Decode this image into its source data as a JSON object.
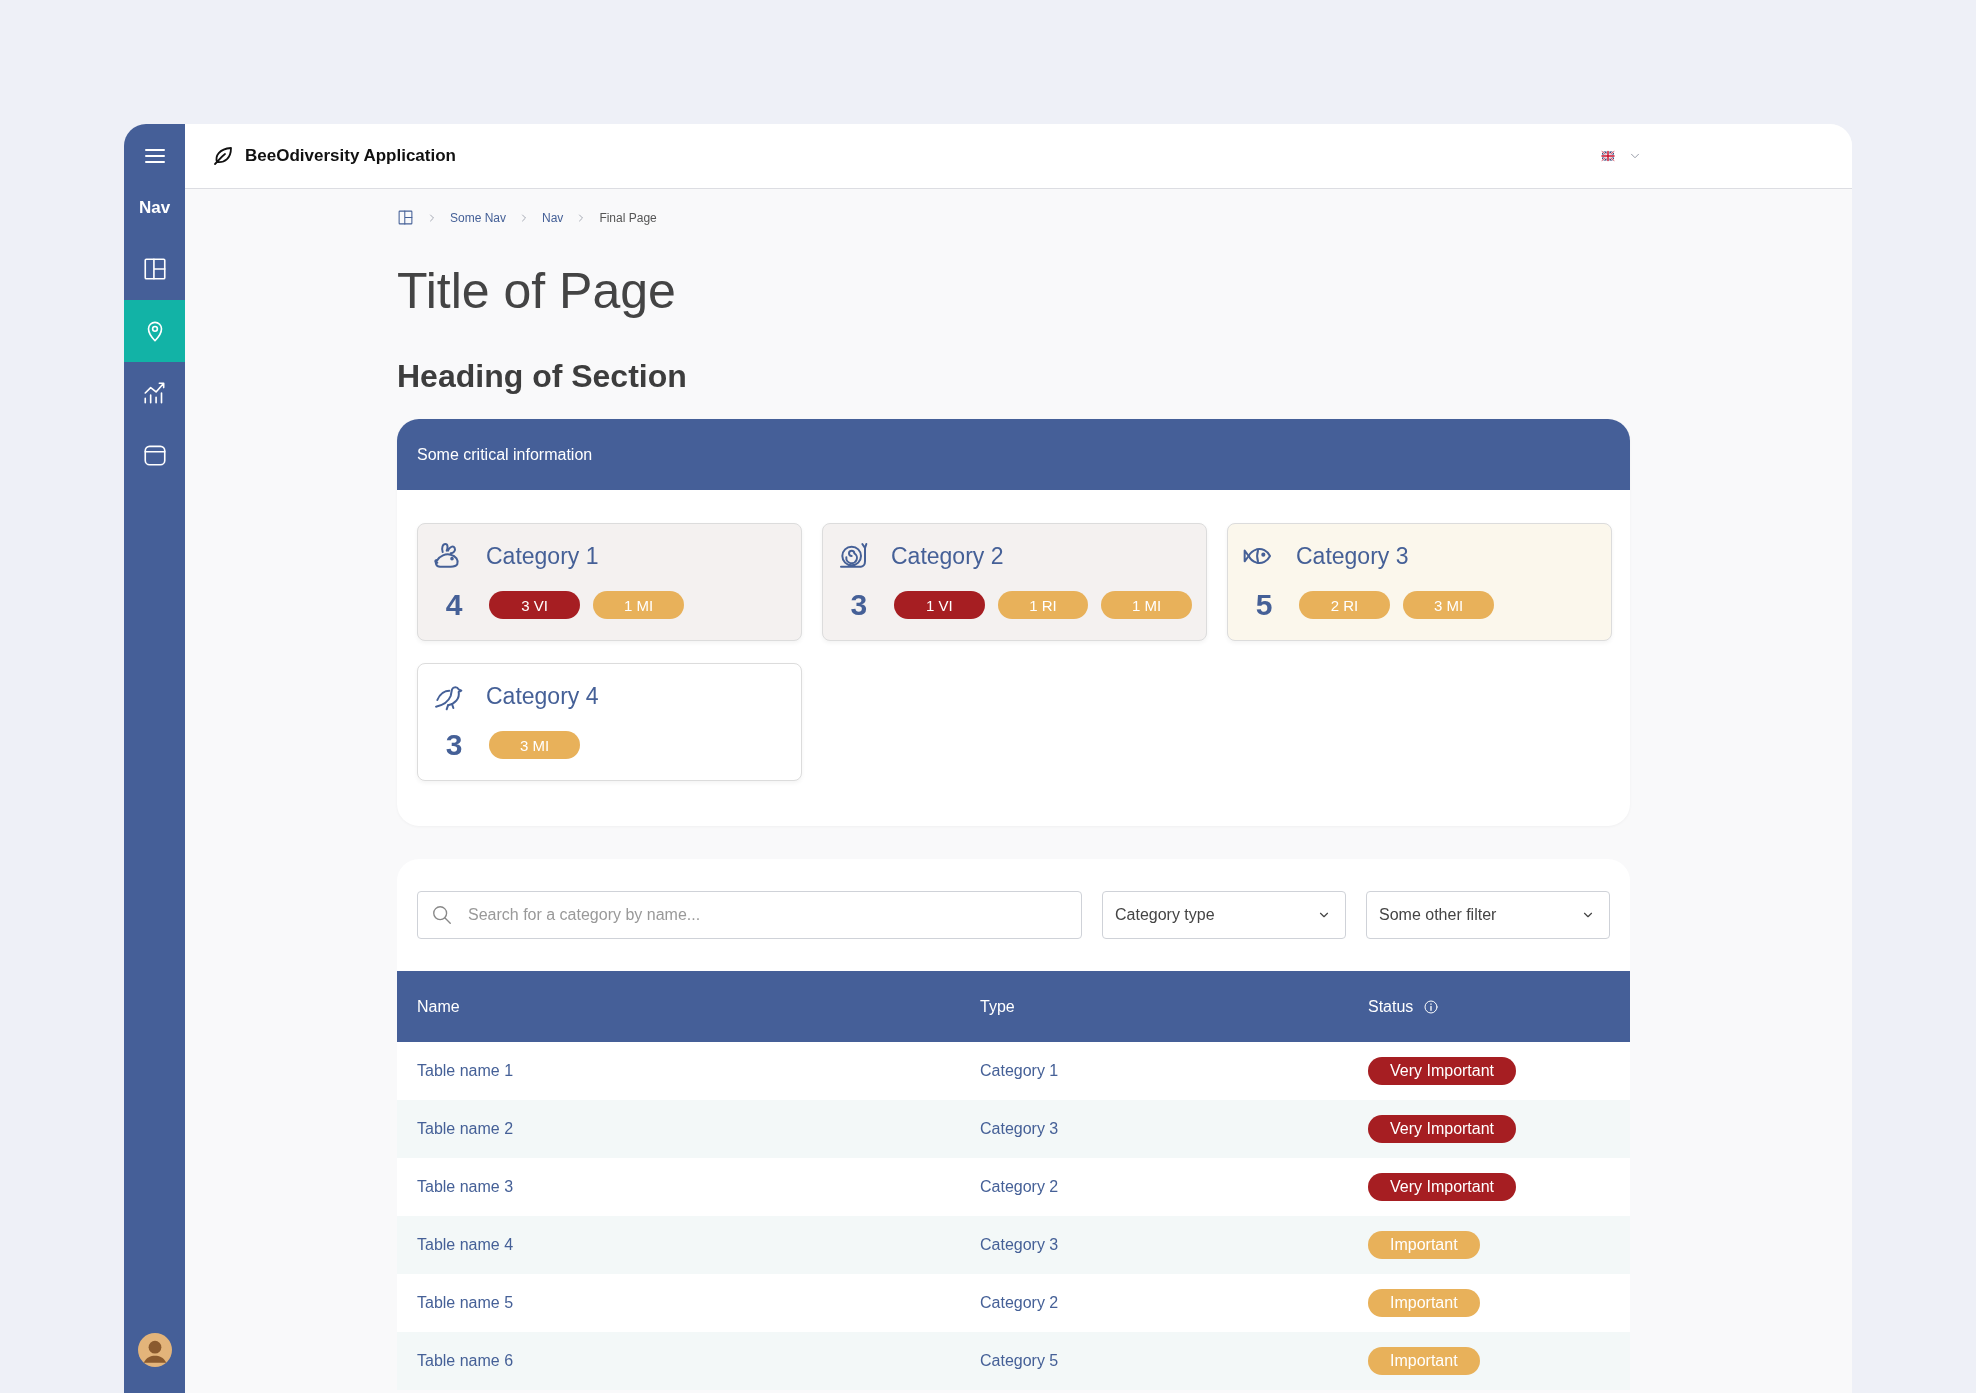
{
  "sidebar": {
    "title": "Nav",
    "items": [
      {
        "selected": false
      },
      {
        "selected": true
      },
      {
        "selected": false
      },
      {
        "selected": false
      }
    ]
  },
  "header": {
    "app_name": "BeeOdiversity Application"
  },
  "breadcrumb": [
    "Some Nav",
    "Nav",
    "Final Page"
  ],
  "page_title": "Title of Page",
  "section_heading": "Heading of Section",
  "info_panel": {
    "title": "Some critical information",
    "cards": [
      {
        "name": "Category 1",
        "count": "4",
        "color": "#f4f1f0",
        "badges": [
          {
            "text": "3 VI",
            "color": "#a61e22"
          },
          {
            "text": "1 MI",
            "color": "#e8b15a"
          }
        ]
      },
      {
        "name": "Category 2",
        "count": "3",
        "color": "#f4f1f0",
        "badges": [
          {
            "text": "1 VI",
            "color": "#a61e22"
          },
          {
            "text": "1 RI",
            "color": "#e8b15a"
          },
          {
            "text": "1 MI",
            "color": "#e8b15a"
          }
        ]
      },
      {
        "name": "Category 3",
        "count": "5",
        "color": "#fbf7ec",
        "badges": [
          {
            "text": "2 RI",
            "color": "#e8b15a"
          },
          {
            "text": "3 MI",
            "color": "#e8b15a"
          }
        ]
      },
      {
        "name": "Category 4",
        "count": "3",
        "color": "#ffffff",
        "badges": [
          {
            "text": "3 MI",
            "color": "#e8b15a"
          }
        ]
      }
    ]
  },
  "filters": {
    "search": {
      "placeholder": "Search for a category by name..."
    },
    "dropdowns": [
      "Category type",
      "Some other filter"
    ]
  },
  "table": {
    "columns": [
      "Name",
      "Type",
      "Status"
    ],
    "rows": [
      {
        "name": "Table name 1",
        "type": "Category 1",
        "status": {
          "text": "Very Important",
          "color": "#a61e22"
        }
      },
      {
        "name": "Table name 2",
        "type": "Category 3",
        "status": {
          "text": "Very Important",
          "color": "#a61e22"
        }
      },
      {
        "name": "Table name 3",
        "type": "Category 2",
        "status": {
          "text": "Very Important",
          "color": "#a61e22"
        }
      },
      {
        "name": "Table name 4",
        "type": "Category 3",
        "status": {
          "text": "Important",
          "color": "#e8b15a"
        }
      },
      {
        "name": "Table name 5",
        "type": "Category 2",
        "status": {
          "text": "Important",
          "color": "#e8b15a"
        }
      },
      {
        "name": "Table name 6",
        "type": "Category 5",
        "status": {
          "text": "Important",
          "color": "#e8b15a"
        }
      }
    ]
  }
}
